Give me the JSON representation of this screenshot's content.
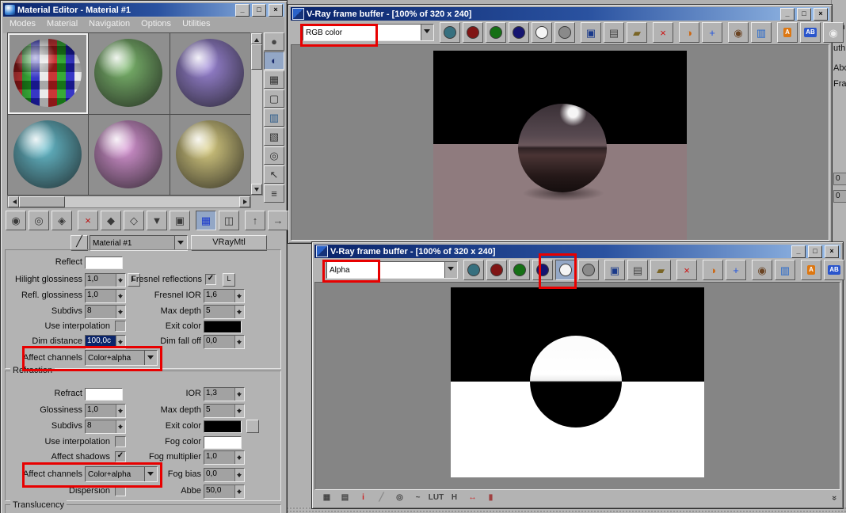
{
  "glyphs": {
    "minimize": "_",
    "maximize": "□",
    "close": "×",
    "chevrons": "»",
    "pick": "╱"
  },
  "material_editor": {
    "title": "Material Editor - Material #1",
    "menu": [
      "Modes",
      "Material",
      "Navigation",
      "Options",
      "Utilities"
    ],
    "samples": [
      {
        "name": "checker-preview",
        "selected": true
      },
      {
        "color": "#7db96e"
      },
      {
        "color": "#9c86d8"
      },
      {
        "color": "#66bccc"
      },
      {
        "color": "#d795d4"
      },
      {
        "color": "#d9cd82"
      }
    ],
    "side_toolbar": [
      {
        "name": "sample-type-button",
        "glyph": "●",
        "color": "#474747"
      },
      {
        "name": "backlight-button",
        "glyph": "◐",
        "color": "#1c2c6e",
        "pressed": true
      },
      {
        "name": "background-button",
        "glyph": "▦",
        "color": "#333333"
      },
      {
        "name": "sample-uv-tiling-button",
        "glyph": "▢",
        "color": "#333333"
      },
      {
        "name": "video-color-check-button",
        "glyph": "▥",
        "color": "#2a5a8a"
      },
      {
        "name": "make-preview-button",
        "glyph": "▧",
        "color": "#333333"
      },
      {
        "name": "options-button",
        "glyph": "◎",
        "color": "#333333"
      },
      {
        "name": "select-by-material-button",
        "glyph": "↖",
        "color": "#333333"
      },
      {
        "name": "material-map-navigator-button",
        "glyph": "≡",
        "color": "#333333"
      }
    ],
    "main_toolbar": [
      {
        "name": "get-material-button",
        "glyph": "◉",
        "color": "#3a3a3a"
      },
      {
        "name": "put-material-to-scene-button",
        "glyph": "◎",
        "color": "#3a3a3a"
      },
      {
        "name": "assign-material-to-selection-button",
        "glyph": "◈",
        "color": "#3a3a3a"
      },
      {
        "name": "reset-map-button",
        "glyph": "×",
        "color": "#bb1111",
        "gap": true
      },
      {
        "name": "make-material-copy-button",
        "glyph": "◆",
        "color": "#3a3a3a"
      },
      {
        "name": "make-unique-button",
        "glyph": "◇",
        "color": "#3a3a3a"
      },
      {
        "name": "put-to-library-button",
        "glyph": "▼",
        "color": "#3a3a3a"
      },
      {
        "name": "material-id-channel-button",
        "glyph": "▣",
        "color": "#3a3a3a"
      },
      {
        "name": "show-map-in-viewport-button",
        "glyph": "▦",
        "color": "#1a3acc",
        "pressed": true,
        "gap": true
      },
      {
        "name": "show-end-result-button",
        "glyph": "◫",
        "color": "#3a3a3a"
      },
      {
        "name": "go-to-parent-button",
        "glyph": "↑",
        "color": "#3a3a3a",
        "gap": true
      },
      {
        "name": "go-forward-to-sibling-button",
        "glyph": "→",
        "color": "#3a3a3a"
      }
    ],
    "name_row": {
      "material_name": "Material #1",
      "material_type": "VRayMtl"
    },
    "params": {
      "reflect_label": "Reflect",
      "reflect_color": "#ffffff",
      "hilight_glossiness_label": "Hilight glossiness",
      "hilight_glossiness_value": "1,0",
      "lock_label": "L",
      "fresnel_reflections_label": "Fresnel reflections",
      "fresnel_reflections_checked": "✓",
      "refl_glossiness_label": "Refl. glossiness",
      "refl_glossiness_value": "1,0",
      "fresnel_ior_label": "Fresnel IOR",
      "fresnel_ior_value": "1,6",
      "subdivs_label": "Subdivs",
      "subdivs_value": "8",
      "max_depth_label": "Max depth",
      "max_depth_value": "5",
      "use_interpolation_label": "Use interpolation",
      "use_interpolation_checked": "",
      "exit_color_label": "Exit color",
      "exit_color_value": "#000000",
      "dim_distance_label": "Dim distance",
      "dim_distance_value": "100,0c",
      "dim_fall_off_label": "Dim fall off",
      "dim_fall_off_value": "0,0",
      "affect_channels_label": "Affect channels",
      "affect_channels_value": "Color+alpha",
      "refraction_section": "Refraction",
      "refract_label": "Refract",
      "refract_color": "#ffffff",
      "ior_label": "IOR",
      "ior_value": "1,3",
      "glossiness_label": "Glossiness",
      "glossiness_value": "1,0",
      "refr_max_depth_label": "Max depth",
      "refr_max_depth_value": "5",
      "refr_subdivs_label": "Subdivs",
      "refr_subdivs_value": "8",
      "refr_exit_color_label": "Exit color",
      "refr_exit_color_value": "#000000",
      "refr_use_interp_label": "Use interpolation",
      "refr_use_interp_checked": "",
      "fog_color_label": "Fog color",
      "fog_color_value": "#ffffff",
      "affect_shadows_label": "Affect shadows",
      "affect_shadows_checked": "✓",
      "fog_multiplier_label": "Fog multiplier",
      "fog_multiplier_value": "1,0",
      "refr_affect_channels_label": "Affect channels",
      "refr_affect_channels_value": "Color+alpha",
      "fog_bias_label": "Fog bias",
      "fog_bias_value": "0,0",
      "dispersion_label": "Dispersion",
      "dispersion_checked": "",
      "abbe_label": "Abbe",
      "abbe_value": "50,0",
      "translucency_section": "Translucency"
    }
  },
  "vfb_top": {
    "title": "V-Ray frame buffer - [100% of 320 x 240]",
    "channel": "RGB color",
    "toolbar": [
      {
        "name": "rgb-color-button",
        "type": "circle",
        "color": "#37707f"
      },
      {
        "name": "red-channel-button",
        "type": "circle",
        "color": "#801515"
      },
      {
        "name": "green-channel-button",
        "type": "circle",
        "color": "#157015"
      },
      {
        "name": "blue-channel-button",
        "type": "circle",
        "color": "#151570"
      },
      {
        "name": "alpha-channel-button",
        "type": "circle",
        "color": "#f4f4f4"
      },
      {
        "name": "monochrome-button",
        "type": "circle",
        "color": "#8a8a8a"
      },
      {
        "name": "save-image-button",
        "glyph": "▣",
        "color": "#1a3a8a",
        "gap": true
      },
      {
        "name": "clone-buffer-button",
        "glyph": "▤",
        "color": "#444444"
      },
      {
        "name": "load-image-button",
        "glyph": "▰",
        "color": "#7a6526"
      },
      {
        "name": "clear-image-button",
        "glyph": "×",
        "color": "#cc1111",
        "gap": true
      },
      {
        "name": "color-corrections-button",
        "glyph": "◑",
        "color": "#cc6611",
        "gap": true
      },
      {
        "name": "track-mouse-button",
        "glyph": "+",
        "color": "#2255dd"
      },
      {
        "name": "region-render-button",
        "glyph": "◉",
        "color": "#6b4423",
        "gap": true
      },
      {
        "name": "duplicate-to-host-button",
        "glyph": "▥",
        "color": "#2266cc"
      },
      {
        "name": "force-clamp-button",
        "glyph": "A",
        "color": "#ffffff",
        "bg": "#dd7711",
        "gap": true
      },
      {
        "name": "compare-ab-button",
        "glyph": "AB",
        "color": "#ffffff",
        "bg": "#2a55cc"
      },
      {
        "name": "render-last-button",
        "glyph": "◉",
        "color": "#eeeeee"
      }
    ]
  },
  "vfb_bottom": {
    "title": "V-Ray frame buffer - [100% of 320 x 240]",
    "channel": "Alpha",
    "toolbar": [
      {
        "name": "rgb-color-button",
        "type": "circle",
        "color": "#37707f"
      },
      {
        "name": "red-channel-button",
        "type": "circle",
        "color": "#801515"
      },
      {
        "name": "green-channel-button",
        "type": "circle",
        "color": "#157015"
      },
      {
        "name": "blue-channel-button",
        "type": "circle",
        "color": "#151570"
      },
      {
        "name": "alpha-channel-button",
        "type": "circle",
        "color": "#f4f4f4",
        "pressed": true
      },
      {
        "name": "monochrome-button",
        "type": "circle",
        "color": "#8a8a8a"
      },
      {
        "name": "save-image-button",
        "glyph": "▣",
        "color": "#1a3a8a",
        "gap": true
      },
      {
        "name": "clone-buffer-button",
        "glyph": "▤",
        "color": "#444444"
      },
      {
        "name": "load-image-button",
        "glyph": "▰",
        "color": "#7a6526"
      },
      {
        "name": "clear-image-button",
        "glyph": "×",
        "color": "#cc1111",
        "gap": true
      },
      {
        "name": "color-corrections-button",
        "glyph": "◑",
        "color": "#cc6611",
        "gap": true
      },
      {
        "name": "track-mouse-button",
        "glyph": "+",
        "color": "#2255dd"
      },
      {
        "name": "region-render-button",
        "glyph": "◉",
        "color": "#6b4423",
        "gap": true
      },
      {
        "name": "duplicate-to-host-button",
        "glyph": "▥",
        "color": "#2266cc"
      },
      {
        "name": "force-clamp-button",
        "glyph": "A",
        "color": "#ffffff",
        "bg": "#dd7711",
        "gap": true
      },
      {
        "name": "compare-ab-button",
        "glyph": "AB",
        "color": "#ffffff",
        "bg": "#2a55cc"
      },
      {
        "name": "render-last-button",
        "glyph": "◉",
        "color": "#eeeeee"
      }
    ],
    "status_icons": [
      {
        "name": "stamp-button",
        "glyph": "▦",
        "color": "#444444"
      },
      {
        "name": "preview-button",
        "glyph": "▤",
        "color": "#444444"
      },
      {
        "name": "info-button",
        "glyph": "i",
        "color": "#cc2222"
      },
      {
        "name": "annotate-button",
        "glyph": "╱",
        "color": "#888888"
      },
      {
        "name": "settings-button",
        "glyph": "◎",
        "color": "#444444"
      },
      {
        "name": "curve-button",
        "glyph": "~",
        "color": "#444444"
      },
      {
        "name": "lut-button",
        "glyph": "LUT",
        "color": "#444444"
      },
      {
        "name": "histogram-button",
        "glyph": "H",
        "color": "#444444"
      },
      {
        "name": "exposure-button",
        "glyph": "↔",
        "color": "#cc2222"
      },
      {
        "name": "stereo-button",
        "glyph": "▮",
        "color": "#a04040"
      }
    ]
  },
  "background_panel": {
    "fragments": [
      "ion",
      "uth",
      "Abo",
      "Fran"
    ],
    "field_values": [
      "0",
      "0"
    ]
  },
  "render": {
    "ground_color": "#8f7b7e"
  }
}
